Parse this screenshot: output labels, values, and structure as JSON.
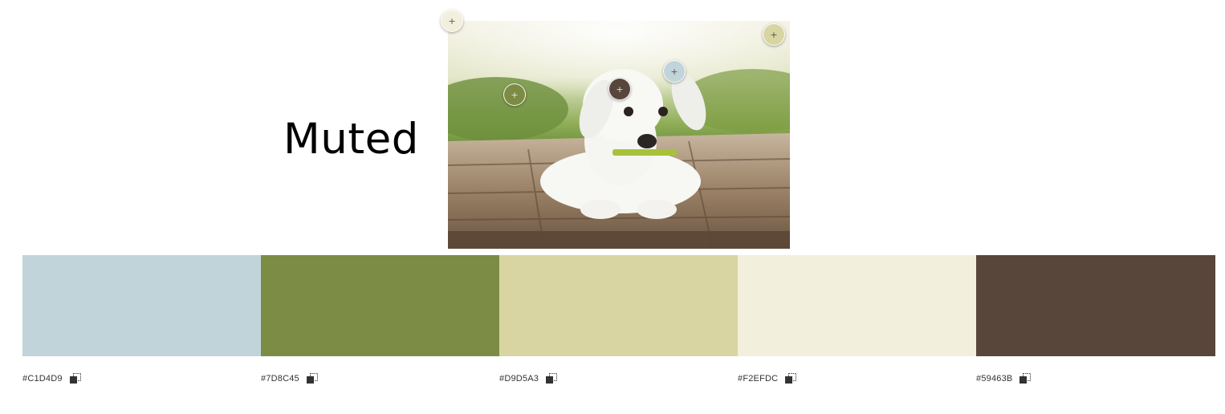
{
  "title": "Muted",
  "photo": {
    "subject": "puppy-photo",
    "pickers": [
      {
        "color": "#F2EFDC"
      },
      {
        "color": "#D9D5A3"
      },
      {
        "color": "#7D8C45"
      },
      {
        "color": "#59463B"
      },
      {
        "color": "#C1D4D9"
      }
    ]
  },
  "palette": [
    {
      "hex": "#C1D4D9",
      "label": "#C1D4D9"
    },
    {
      "hex": "#7D8C45",
      "label": "#7D8C45"
    },
    {
      "hex": "#D9D5A3",
      "label": "#D9D5A3"
    },
    {
      "hex": "#F2EFDC",
      "label": "#F2EFDC"
    },
    {
      "hex": "#59463B",
      "label": "#59463B"
    }
  ],
  "icons": {
    "copy": "copy-icon",
    "picker": "plus-icon"
  }
}
